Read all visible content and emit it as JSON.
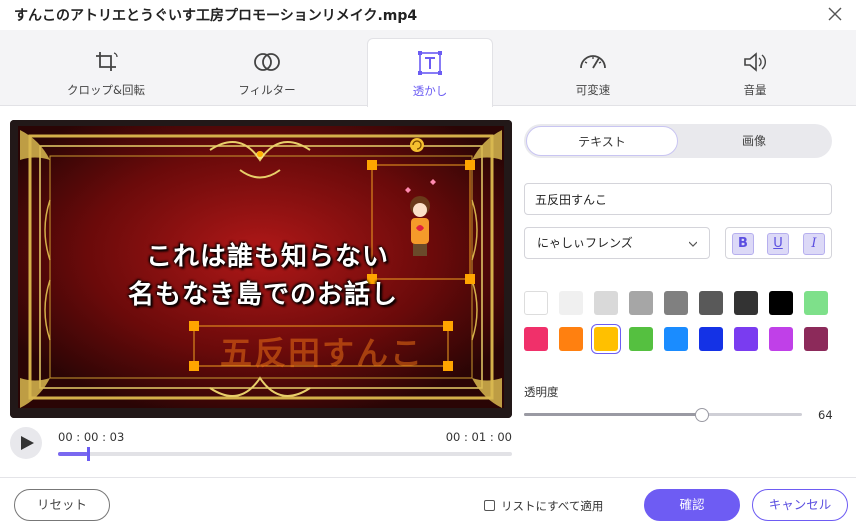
{
  "window": {
    "title": "すんこのアトリエとうぐいす工房プロモーションリメイク.mp4"
  },
  "tabs": [
    {
      "label": "クロップ&回転",
      "icon": "crop-rotate-icon"
    },
    {
      "label": "フィルター",
      "icon": "filter-icon"
    },
    {
      "label": "透かし",
      "icon": "watermark-text-icon",
      "active": true
    },
    {
      "label": "可変速",
      "icon": "speedometer-icon"
    },
    {
      "label": "音量",
      "icon": "volume-icon"
    }
  ],
  "preview": {
    "caption_line1": "これは誰も知らない",
    "caption_line2": "名もなき島でのお話し",
    "watermark_text": "五反田すんこ"
  },
  "playback": {
    "current_time": "00 : 00 : 03",
    "total_time": "00 : 01 : 00",
    "progress": 0.065
  },
  "panel": {
    "segment": {
      "text_label": "テキスト",
      "image_label": "画像"
    },
    "watermark_input": {
      "value": "五反田すんこ"
    },
    "font": {
      "selected": "にゃしぃフレンズ"
    },
    "style": {
      "bold": "B",
      "underline": "U",
      "italic": "I"
    },
    "colors": [
      "#ffffff",
      "#f0f0f0",
      "#d9d9d9",
      "#a6a6a6",
      "#808080",
      "#595959",
      "#333333",
      "#000000",
      "#7ee08a",
      "#f0306a",
      "#ff8010",
      "#ffc000",
      "#55c040",
      "#1a8cff",
      "#1432e6",
      "#7a3cf0",
      "#c040e8",
      "#8c2a5a"
    ],
    "selected_color": "#ffc000",
    "opacity": {
      "label": "透明度",
      "value": "64",
      "fraction": 0.64
    }
  },
  "footer": {
    "reset_label": "リセット",
    "apply_all_label": "リストにすべて適用",
    "ok_label": "確認",
    "cancel_label": "キャンセル"
  },
  "colors": {
    "accent": "#6e5cf3"
  }
}
